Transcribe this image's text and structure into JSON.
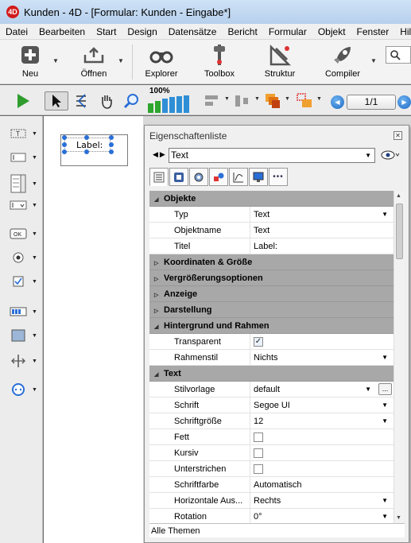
{
  "window": {
    "title": "Kunden - 4D - [Formular: Kunden -  Eingabe*]",
    "app_icon_text": "4D"
  },
  "menu": [
    "Datei",
    "Bearbeiten",
    "Start",
    "Design",
    "Datensätze",
    "Bericht",
    "Formular",
    "Objekt",
    "Fenster",
    "Hilfe"
  ],
  "toolbar": {
    "new": "Neu",
    "open": "Öffnen",
    "explorer": "Explorer",
    "toolbox": "Toolbox",
    "structure": "Struktur",
    "compiler": "Compiler"
  },
  "toolbar2": {
    "zoom": "100%",
    "page": "1/1"
  },
  "form": {
    "label_text": "Label:"
  },
  "properties": {
    "title": "Eigenschaftenliste",
    "selected_object": "Text",
    "footer": "Alle Themen",
    "sections": {
      "objekte": "Objekte",
      "koordinaten": "Koordinaten & Größe",
      "vergroesserung": "Vergrößerungsoptionen",
      "anzeige": "Anzeige",
      "darstellung": "Darstellung",
      "hintergrund": "Hintergrund und Rahmen",
      "text": "Text"
    },
    "rows": {
      "typ": {
        "name": "Typ",
        "value": "Text"
      },
      "objektname": {
        "name": "Objektname",
        "value": "Text"
      },
      "titel": {
        "name": "Titel",
        "value": "Label:"
      },
      "transparent": {
        "name": "Transparent",
        "checked": true
      },
      "rahmenstil": {
        "name": "Rahmenstil",
        "value": "Nichts"
      },
      "stilvorlage": {
        "name": "Stilvorlage",
        "value": "default",
        "button": "..."
      },
      "schrift": {
        "name": "Schrift",
        "value": "Segoe UI"
      },
      "schriftgroesse": {
        "name": "Schriftgröße",
        "value": "12"
      },
      "fett": {
        "name": "Fett",
        "checked": false
      },
      "kursiv": {
        "name": "Kursiv",
        "checked": false
      },
      "unterstrichen": {
        "name": "Unterstrichen",
        "checked": false
      },
      "schriftfarbe": {
        "name": "Schriftfarbe",
        "value": "Automatisch"
      },
      "horizontal": {
        "name": "Horizontale Aus...",
        "value": "Rechts"
      },
      "rotation": {
        "name": "Rotation",
        "value": "0°"
      }
    }
  }
}
